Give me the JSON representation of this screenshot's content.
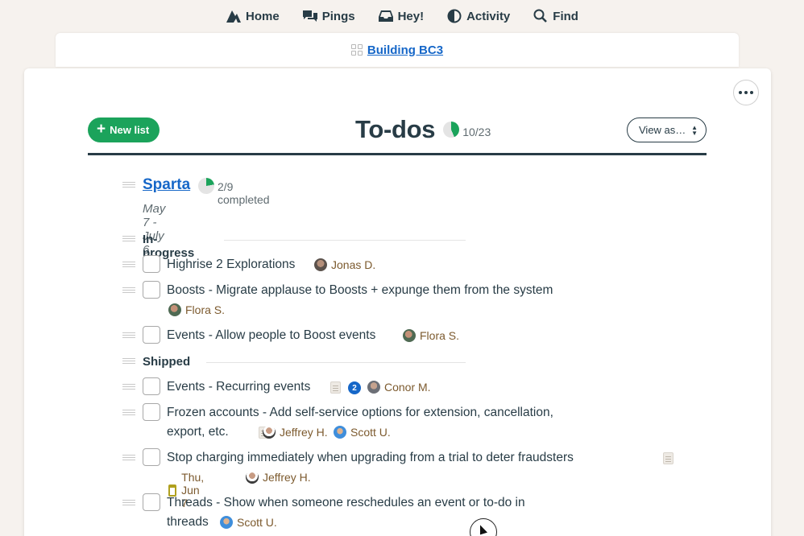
{
  "nav": {
    "items": [
      {
        "label": "Home",
        "icon": "home-icon"
      },
      {
        "label": "Pings",
        "icon": "pings-icon"
      },
      {
        "label": "Hey!",
        "icon": "hey-icon"
      },
      {
        "label": "Activity",
        "icon": "activity-icon"
      },
      {
        "label": "Find",
        "icon": "search-icon"
      }
    ]
  },
  "project": {
    "name": "Building BC3"
  },
  "header": {
    "new_list_label": "New list",
    "title": "To-dos",
    "progress_label": "10/23",
    "progress_fraction": 0.435,
    "view_as_label": "View as…"
  },
  "list": {
    "title": "Sparta",
    "completed_label": "2/9 completed",
    "progress_fraction": 0.222,
    "dates": "May 7 - July 6"
  },
  "groups": [
    {
      "title": "In-progress",
      "todos": [
        {
          "line1": "Highrise 2 Explorations",
          "assignee": "Jonas D."
        },
        {
          "line1": "Boosts - Migrate applause to Boosts + expunge them from the system",
          "assignee": "Flora S."
        },
        {
          "line1": "Events - Allow people to Boost events",
          "assignee": "Flora S."
        }
      ]
    },
    {
      "title": "Shipped",
      "todos": [
        {
          "line1": "Events - Recurring events",
          "comments": "2",
          "assignee": "Conor M."
        },
        {
          "line1": "Frozen accounts - Add self-service options for extension, cancellation,",
          "line2": "export, etc.",
          "assignees": [
            "Jeffrey H.",
            "Scott U."
          ]
        },
        {
          "line1": "Stop charging immediately when upgrading from a trial to deter fraudsters",
          "due": "Thu, Jun 7",
          "assignee": "Jeffrey H."
        },
        {
          "line1": "Threads - Show when someone reschedules an event or to-do in",
          "line2": "threads",
          "assignee": "Scott U."
        }
      ]
    }
  ],
  "colors": {
    "accent_green": "#1ba35b",
    "link_blue": "#1667c8",
    "text_dark": "#283c46",
    "person_brown": "#7c5a2e"
  }
}
